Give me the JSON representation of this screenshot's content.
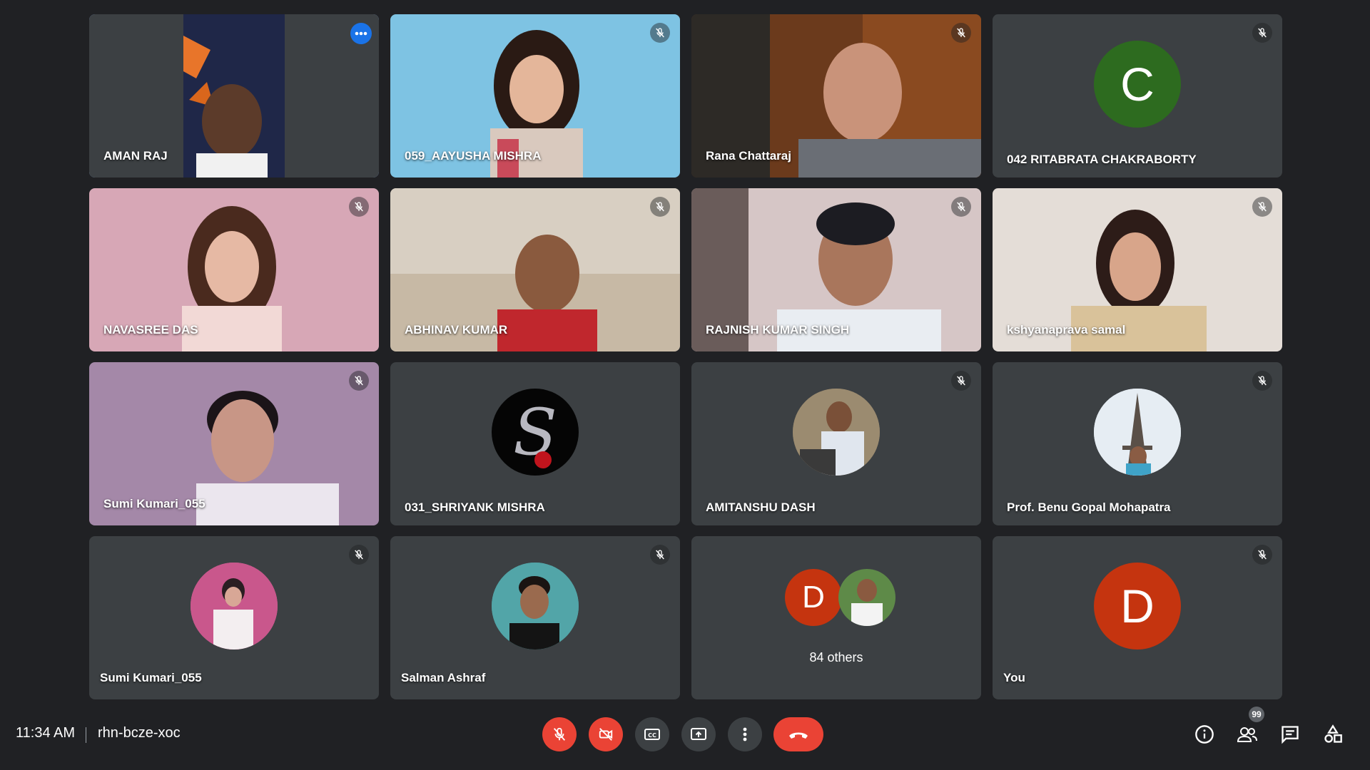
{
  "participants": [
    {
      "name": "AMAN RAJ"
    },
    {
      "name": "059_AAYUSHA MISHRA"
    },
    {
      "name": "Rana Chattaraj"
    },
    {
      "name": "042 RITABRATA CHAKRABORTY",
      "initial": "C",
      "avatar_color": "#2d6b1f"
    },
    {
      "name": "NAVASREE DAS"
    },
    {
      "name": "ABHINAV KUMAR"
    },
    {
      "name": "RAJNISH KUMAR SINGH"
    },
    {
      "name": "kshyanaprava samal"
    },
    {
      "name": "Sumi Kumari_055"
    },
    {
      "name": "031_SHRIYANK MISHRA"
    },
    {
      "name": "AMITANSHU DASH"
    },
    {
      "name": "Prof. Benu Gopal Mohapatra"
    },
    {
      "name": "Sumi Kumari_055"
    },
    {
      "name": "Salman Ashraf"
    },
    {
      "name": "84 others",
      "initial": "D",
      "avatar_color": "#c5340f"
    },
    {
      "name": "You",
      "initial": "D",
      "avatar_color": "#c5340f"
    }
  ],
  "meeting": {
    "time": "11:34 AM",
    "code": "rhn-bcze-xoc",
    "participant_count": "99"
  },
  "colors": {
    "background": "#202124",
    "tile": "#3c4043",
    "active_border": "#8ab4f8",
    "danger": "#ea4335"
  }
}
